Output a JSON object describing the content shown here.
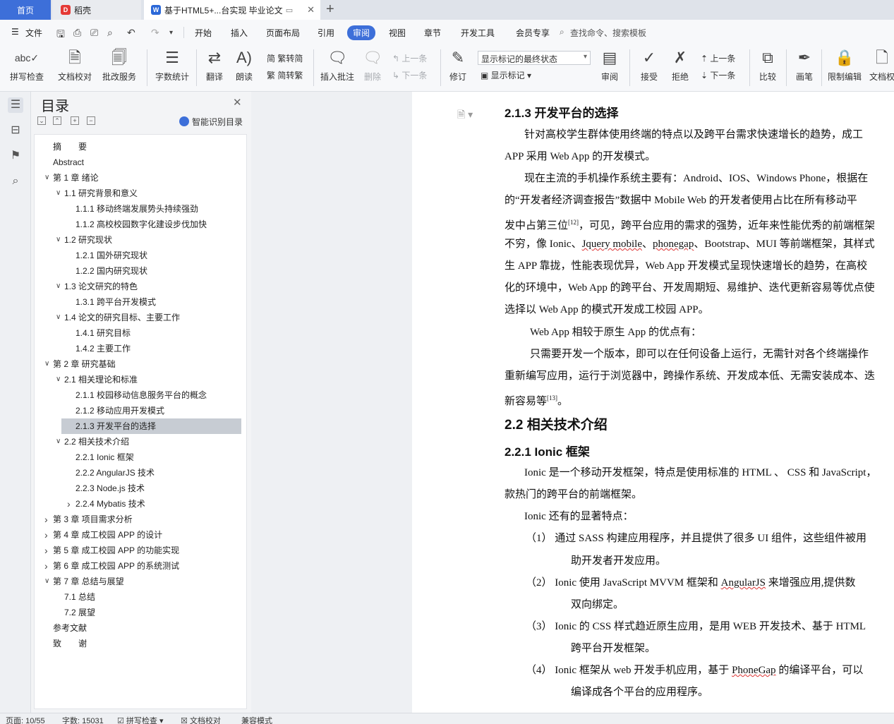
{
  "tabs": {
    "home": "首页",
    "daoke": "稻壳",
    "doc": "基于HTML5+...台实现 毕业论文"
  },
  "menu": {
    "file": "文件",
    "items": [
      "开始",
      "插入",
      "页面布局",
      "引用",
      "审阅",
      "视图",
      "章节",
      "开发工具",
      "会员专享"
    ],
    "active": "审阅",
    "search": "查找命令、搜索模板"
  },
  "ribbon": {
    "spell": "拼写检查",
    "doc_check": "文档校对",
    "annotate_service": "批改服务",
    "word_count": "字数统计",
    "translate": "翻译",
    "read": "朗读",
    "trad": "繁转简",
    "simp": "简转繁",
    "insert_comment": "插入批注",
    "delete": "删除",
    "prev1": "上一条",
    "next1": "下一条",
    "revise": "修订",
    "markup_select": "显示标记的最终状态",
    "show_markup": "显示标记",
    "review": "审阅",
    "accept": "接受",
    "reject": "拒绝",
    "prev2": "上一条",
    "next2": "下一条",
    "compare": "比较",
    "pen": "画笔",
    "restrict": "限制编辑",
    "doc_perm": "文档权"
  },
  "toc": {
    "title": "目录",
    "smart": "智能识别目录",
    "items": [
      {
        "t": "摘　　要",
        "lvl": 0,
        "arrow": ""
      },
      {
        "t": "Abstract",
        "lvl": 0,
        "arrow": ""
      },
      {
        "t": "第 1 章  绪论",
        "lvl": 0,
        "arrow": "down"
      },
      {
        "t": "1.1 研究背景和意义",
        "lvl": 1,
        "arrow": "down"
      },
      {
        "t": "1.1.1 移动终端发展势头持续强劲",
        "lvl": 2,
        "arrow": ""
      },
      {
        "t": "1.1.2 高校校园数字化建设步伐加快",
        "lvl": 2,
        "arrow": ""
      },
      {
        "t": "1.2  研究现状",
        "lvl": 1,
        "arrow": "down"
      },
      {
        "t": "1.2.1 国外研究现状",
        "lvl": 2,
        "arrow": ""
      },
      {
        "t": "1.2.2 国内研究现状",
        "lvl": 2,
        "arrow": ""
      },
      {
        "t": "1.3  论文研究的特色",
        "lvl": 1,
        "arrow": "down"
      },
      {
        "t": "1.3.1 跨平台开发模式",
        "lvl": 2,
        "arrow": ""
      },
      {
        "t": "1.4  论文的研究目标、主要工作",
        "lvl": 1,
        "arrow": "down"
      },
      {
        "t": "1.4.1 研究目标",
        "lvl": 2,
        "arrow": ""
      },
      {
        "t": "1.4.2 主要工作",
        "lvl": 2,
        "arrow": ""
      },
      {
        "t": "第 2 章  研究基础",
        "lvl": 0,
        "arrow": "down"
      },
      {
        "t": "2.1 相关理论和标准",
        "lvl": 1,
        "arrow": "down"
      },
      {
        "t": "2.1.1 校园移动信息服务平台的概念",
        "lvl": 2,
        "arrow": ""
      },
      {
        "t": "2.1.2 移动应用开发模式",
        "lvl": 2,
        "arrow": ""
      },
      {
        "t": "2.1.3 开发平台的选择",
        "lvl": 2,
        "arrow": "",
        "selected": true
      },
      {
        "t": "2.2 相关技术介绍",
        "lvl": 1,
        "arrow": "down"
      },
      {
        "t": "2.2.1 Ionic 框架",
        "lvl": 2,
        "arrow": ""
      },
      {
        "t": "2.2.2 AngularJS  技术",
        "lvl": 2,
        "arrow": ""
      },
      {
        "t": "2.2.3 Node.js  技术",
        "lvl": 2,
        "arrow": ""
      },
      {
        "t": "2.2.4 Mybatis  技术",
        "lvl": 2,
        "arrow": "right"
      },
      {
        "t": "第 3 章  项目需求分析",
        "lvl": 0,
        "arrow": "right"
      },
      {
        "t": "第 4 章  成工校园 APP 的设计",
        "lvl": 0,
        "arrow": "right"
      },
      {
        "t": "第 5 章  成工校园 APP 的功能实现",
        "lvl": 0,
        "arrow": "right"
      },
      {
        "t": "第 6 章  成工校园 APP 的系统测试",
        "lvl": 0,
        "arrow": "right"
      },
      {
        "t": "第 7 章  总结与展望",
        "lvl": 0,
        "arrow": "down"
      },
      {
        "t": "7.1 总结",
        "lvl": 1,
        "arrow": ""
      },
      {
        "t": "7.2 展望",
        "lvl": 1,
        "arrow": ""
      },
      {
        "t": "参考文献",
        "lvl": 0,
        "arrow": ""
      },
      {
        "t": "致　　谢",
        "lvl": 0,
        "arrow": ""
      }
    ]
  },
  "doc": {
    "h213": "2.1.3 开发平台的选择",
    "p1a": "针对高校学生群体使用终端的特点以及跨平台需求快速增长的趋势，成工",
    "p1b": "APP 采用 Web App 的开发模式。",
    "p2a": "现在主流的手机操作系统主要有：Android、IOS、Windows Phone，根据在",
    "p2b": "的“开发者经济调查报告”数据中 Mobile Web 的开发者使用占比在所有移动平",
    "p2c_pre": "发中占第三位",
    "p2c_ref": "[12]",
    "p2c_post": "，可见，跨平台应用的需求的强势，近年来性能优秀的前端框架",
    "p2d_1": "不穷，像 Ionic、",
    "p2d_jq": "Jquery mobile",
    "p2d_2": "、",
    "p2d_pg": "phonegap",
    "p2d_3": "、Bootstrap、MUI 等前端框架，其样式",
    "p2e": "生 APP 靠拢，性能表现优异，Web App 开发模式呈现快速增长的趋势，在高校",
    "p2f": "化的环境中，Web App 的跨平台、开发周期短、易维护、迭代更新容易等优点使",
    "p2g": "选择以 Web App 的模式开发成工校园 APP。",
    "p3": "Web App 相较于原生 App 的优点有：",
    "p4a": "只需要开发一个版本，即可以在任何设备上运行，无需针对各个终端操作",
    "p4b": "重新编写应用，运行于浏览器中，跨操作系统、开发成本低、无需安装成本、迭",
    "p4c_pre": "新容易等",
    "p4c_ref": "[13]",
    "p4c_post": "。",
    "h22": "2.2 相关技术介绍",
    "h221": "2.2.1 Ionic 框架",
    "p5a": "Ionic 是一个移动开发框架，特点是使用标准的 HTML 、 CSS 和 JavaScript，",
    "p5b": "款热门的跨平台的前端框架。",
    "p6": "Ionic 还有的显著特点：",
    "l1a": "（1）    通过 SASS 构建应用程序，并且提供了很多  UI 组件，这些组件被用",
    "l1b": "助开发者开发应用。",
    "l2a_1": "（2）    Ionic 使用 JavaScript MVVM  框架和  ",
    "l2a_ng": "AngularJS",
    "l2a_2": "  来增强应用,提供数",
    "l2b": "双向绑定。",
    "l3a": "（3）    Ionic 的 CSS 样式趋近原生应用，是用 WEB 开发技术、基于 HTML",
    "l3b": "跨平台开发框架。",
    "l4a_1": "（4）    Ionic 框架从 web 开发手机应用，基于 ",
    "l4a_pg": "PhoneGap",
    "l4a_2": " 的编译平台，可以",
    "l4b": "编译成各个平台的应用程序。"
  },
  "status": {
    "page": "页面: 10/55",
    "words": "字数: 15031",
    "spell": "拼写检查",
    "proof": "文档校对",
    "compat": "兼容模式"
  }
}
